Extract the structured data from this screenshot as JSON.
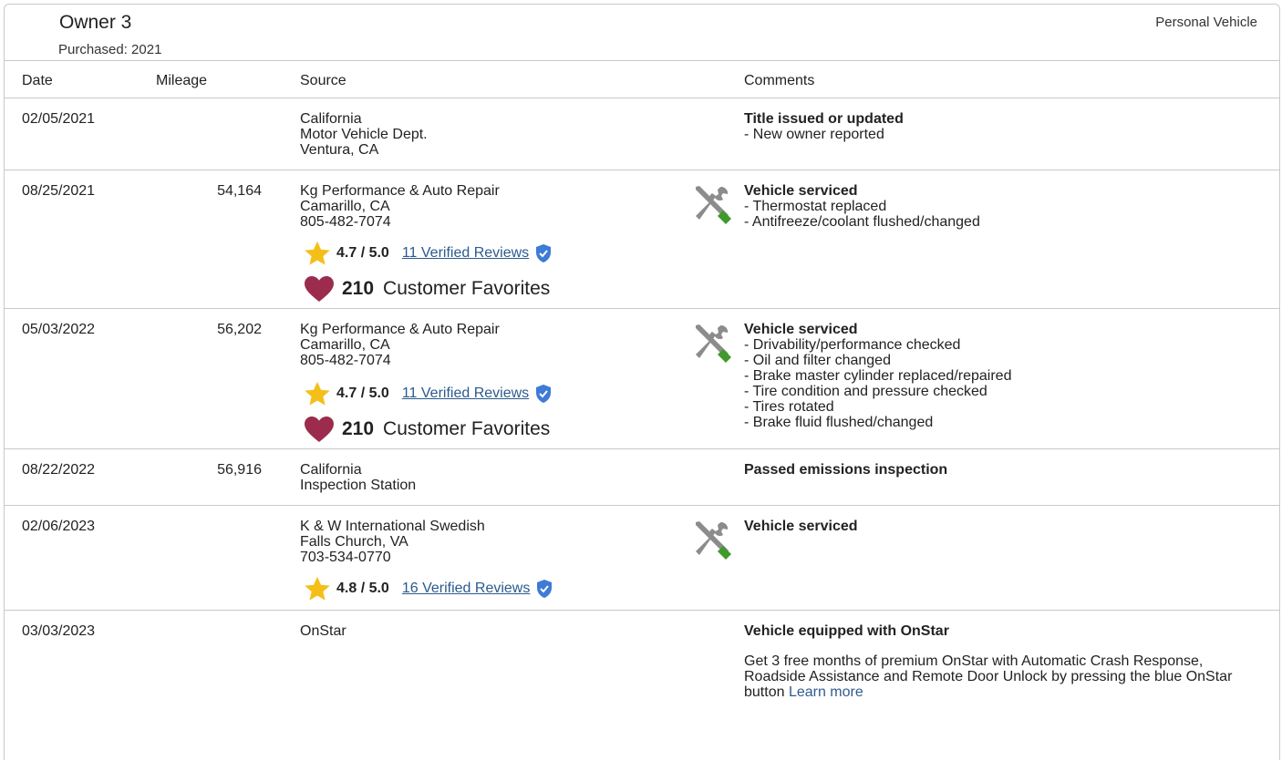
{
  "owner": {
    "title": "Owner 3",
    "purchased": "Purchased: 2021",
    "vehicle_type": "Personal Vehicle"
  },
  "table": {
    "headers": {
      "date": "Date",
      "mileage": "Mileage",
      "source": "Source",
      "comments": "Comments"
    },
    "rows": [
      {
        "date": "02/05/2021",
        "mileage": "",
        "source": [
          "California",
          "Motor Vehicle Dept.",
          "Ventura, CA"
        ],
        "comment_title": "Title issued or updated",
        "comment_items": [
          "- New owner reported"
        ]
      },
      {
        "date": "08/25/2021",
        "mileage": "54,164",
        "source": [
          "Kg Performance & Auto Repair",
          "Camarillo, CA",
          "805-482-7074"
        ],
        "rating": {
          "score": "4.7 / 5.0",
          "reviews": "11 Verified Reviews"
        },
        "favorites": {
          "count": "210",
          "label": "Customer Favorites"
        },
        "icon": "service-tools-icon",
        "comment_title": "Vehicle serviced",
        "comment_items": [
          "- Thermostat replaced",
          "- Antifreeze/coolant flushed/changed"
        ]
      },
      {
        "date": "05/03/2022",
        "mileage": "56,202",
        "source": [
          "Kg Performance & Auto Repair",
          "Camarillo, CA",
          "805-482-7074"
        ],
        "rating": {
          "score": "4.7 / 5.0",
          "reviews": "11 Verified Reviews"
        },
        "favorites": {
          "count": "210",
          "label": "Customer Favorites"
        },
        "icon": "service-tools-icon",
        "comment_title": "Vehicle serviced",
        "comment_items": [
          "- Drivability/performance checked",
          "- Oil and filter changed",
          "- Brake master cylinder replaced/repaired",
          "- Tire condition and pressure checked",
          "- Tires rotated",
          "- Brake fluid flushed/changed"
        ]
      },
      {
        "date": "08/22/2022",
        "mileage": "56,916",
        "source": [
          "California",
          "Inspection Station"
        ],
        "comment_title": "Passed emissions inspection",
        "comment_items": []
      },
      {
        "date": "02/06/2023",
        "mileage": "",
        "source": [
          "K & W International Swedish",
          "Falls Church, VA",
          "703-534-0770"
        ],
        "rating": {
          "score": "4.8 / 5.0",
          "reviews": "16 Verified Reviews"
        },
        "icon": "service-tools-icon",
        "comment_title": "Vehicle serviced",
        "comment_items": []
      },
      {
        "date": "03/03/2023",
        "mileage": "",
        "source": [
          "OnStar"
        ],
        "comment_title": "Vehicle equipped with OnStar",
        "comment_items": [],
        "comment_paragraph": "Get 3 free months of premium OnStar with Automatic Crash Response, Roadside Assistance and Remote Door Unlock by pressing the blue OnStar button",
        "comment_link": "Learn more"
      }
    ]
  },
  "colors": {
    "star": "#f5bf19",
    "heart": "#9b2c4e",
    "link": "#2c5a8c",
    "verified_shield": "#3d7bd6",
    "tool_gray": "#8c8c8c",
    "tool_green": "#3f9a2b"
  }
}
